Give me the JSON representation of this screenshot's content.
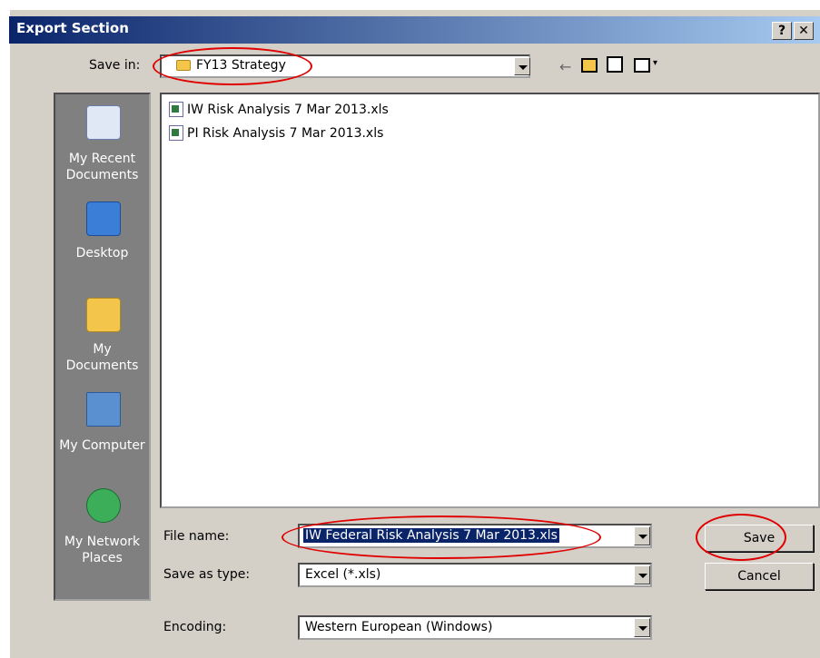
{
  "window": {
    "title": "Export Section",
    "help_btn": "?",
    "close_btn": "✕"
  },
  "save_in": {
    "label": "Save in:",
    "value": "FY13 Strategy"
  },
  "toolbar": {
    "back": "back-icon",
    "up": "up-folder-icon",
    "new_folder": "new-folder-icon",
    "views": "views-icon"
  },
  "places": [
    {
      "label": "My Recent Documents",
      "icon": "recent-documents-icon"
    },
    {
      "label": "Desktop",
      "icon": "desktop-icon"
    },
    {
      "label": "My Documents",
      "icon": "my-documents-icon"
    },
    {
      "label": "My Computer",
      "icon": "my-computer-icon"
    },
    {
      "label": "My Network Places",
      "icon": "network-places-icon"
    }
  ],
  "files": [
    {
      "name": "IW Risk Analysis 7 Mar 2013.xls"
    },
    {
      "name": "PI Risk Analysis 7 Mar 2013.xls"
    }
  ],
  "form": {
    "file_name_label": "File name:",
    "file_name_value": "IW Federal Risk Analysis 7 Mar 2013.xls",
    "save_as_type_label": "Save as type:",
    "save_as_type_value": "Excel (*.xls)",
    "encoding_label": "Encoding:",
    "encoding_value": "Western European (Windows)"
  },
  "buttons": {
    "save": "Save",
    "cancel": "Cancel"
  },
  "colors": {
    "title_bar": "#0a246a",
    "highlight_ellipse": "#e00000",
    "places_bar": "#808080"
  }
}
